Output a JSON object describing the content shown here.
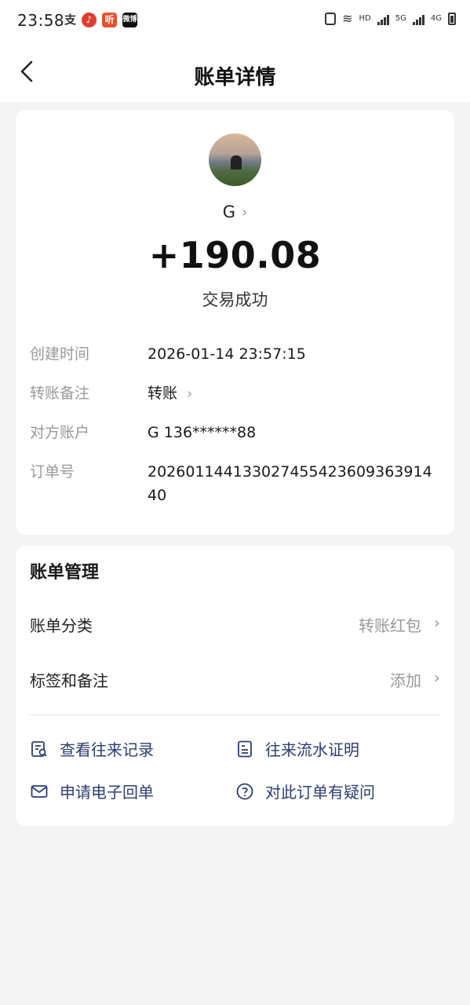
{
  "status_bar": {
    "time": "23:58",
    "apps": [
      "支",
      "",
      "听",
      "微博"
    ],
    "network_labels": [
      "HD",
      "5G",
      "4G"
    ]
  },
  "header": {
    "title": "账单详情"
  },
  "transaction": {
    "name": "G",
    "amount": "+190.08",
    "status": "交易成功",
    "details": [
      {
        "label": "创建时间",
        "value": "2026-01-14 23:57:15"
      },
      {
        "label": "转账备注",
        "value": "转账"
      },
      {
        "label": "对方账户",
        "value": "G 136******88"
      },
      {
        "label": "订单号",
        "value": "20260114413302745542360936391440"
      }
    ]
  },
  "management": {
    "title": "账单管理",
    "category": {
      "label": "账单分类",
      "value": "转账红包"
    },
    "tags": {
      "label": "标签和备注",
      "value": "添加"
    },
    "actions": [
      {
        "label": "查看往来记录",
        "icon": "record-search-icon"
      },
      {
        "label": "往来流水证明",
        "icon": "document-icon"
      },
      {
        "label": "申请电子回单",
        "icon": "mail-icon"
      },
      {
        "label": "对此订单有疑问",
        "icon": "question-circle-icon"
      }
    ]
  },
  "colors": {
    "background": "#f4f4f4",
    "card": "#ffffff",
    "action_text": "#2c3e70",
    "label_gray": "#999999"
  }
}
